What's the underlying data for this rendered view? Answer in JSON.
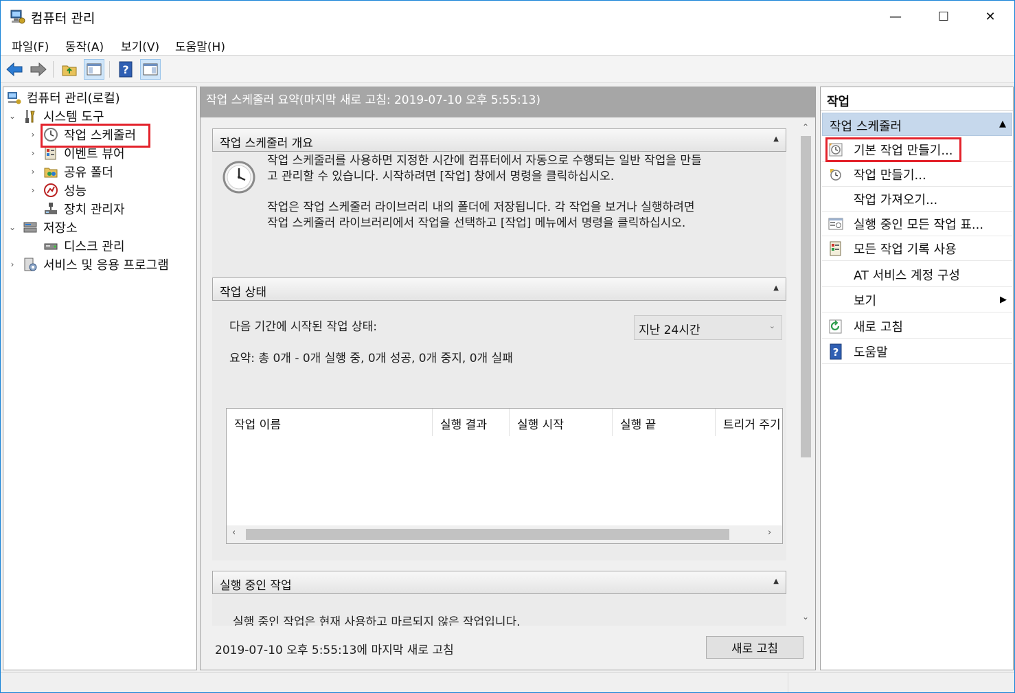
{
  "window": {
    "title": "컴퓨터 관리",
    "min_glyph": "—",
    "max_glyph": "☐",
    "close_glyph": "✕"
  },
  "menu": [
    "파일(F)",
    "동작(A)",
    "보기(V)",
    "도움말(H)"
  ],
  "toolbar": {
    "icons": [
      "back-arrow-icon",
      "forward-arrow-icon",
      "up-folder-icon",
      "show-hide-tree-icon",
      "help-icon",
      "show-hide-action-pane-icon"
    ]
  },
  "tree": {
    "items": [
      {
        "label": "컴퓨터 관리(로컬)",
        "expander": "",
        "icon": "computer-management-icon"
      },
      {
        "label": "시스템 도구",
        "expander": "⌄",
        "icon": "system-tools-icon"
      },
      {
        "label": "작업 스케줄러",
        "expander": "›",
        "icon": "clock-icon",
        "selected": true
      },
      {
        "label": "이벤트 뷰어",
        "expander": "›",
        "icon": "event-viewer-icon"
      },
      {
        "label": "공유 폴더",
        "expander": "›",
        "icon": "shared-folder-icon"
      },
      {
        "label": "성능",
        "expander": "›",
        "icon": "performance-icon"
      },
      {
        "label": "장치 관리자",
        "expander": "",
        "icon": "device-manager-icon"
      },
      {
        "label": "저장소",
        "expander": "⌄",
        "icon": "storage-icon"
      },
      {
        "label": "디스크 관리",
        "expander": "",
        "icon": "disk-management-icon"
      },
      {
        "label": "서비스 및 응용 프로그램",
        "expander": "›",
        "icon": "services-icon"
      }
    ]
  },
  "center": {
    "header": "작업 스케줄러 요약(마지막 새로 고침: 2019-07-10 오후 5:55:13)",
    "overview": {
      "title": "작업 스케줄러 개요",
      "caret": "▲",
      "para1_line1": "작업 스케줄러를 사용하면 지정한 시간에 컴퓨터에서 자동으로 수행되는 일반 작업을 만들",
      "para1_line2": "고 관리할 수 있습니다. 시작하려면 [작업] 창에서 명령을 클릭하십시오.",
      "para2_line1": "작업은 작업 스케줄러 라이브러리 내의 폴더에 저장됩니다. 각 작업을 보거나 실행하려면",
      "para2_line2": "작업 스케줄러 라이브러리에서 작업을 선택하고 [작업] 메뉴에서 명령을 클릭하십시오."
    },
    "status": {
      "title": "작업 상태",
      "caret": "▲",
      "period_label": "다음 기간에 시작된 작업 상태:",
      "period_value": "지난 24시간",
      "summary": "요약: 총 0개 - 0개 실행 중, 0개 성공, 0개 중지, 0개 실패",
      "columns": [
        "작업 이름",
        "실행 결과",
        "실행 시작",
        "실행 끝",
        "트리거 주기"
      ],
      "scroll_left": "‹",
      "scroll_right": "›"
    },
    "running": {
      "title": "실행 중인 작업",
      "caret": "▲",
      "text": "실행 중인 작업은 현재 사용하고 마르되지 않은 작업입니다."
    },
    "scroll_up": "⌃",
    "scroll_down": "⌄",
    "footer_text": "2019-07-10 오후 5:55:13에 마지막 새로 고침",
    "refresh_button": "새로 고침"
  },
  "actions": {
    "title": "작업",
    "group": "작업 스케줄러",
    "group_glyph": "▲",
    "submenu_glyph": "▶",
    "items": [
      {
        "label": "기본 작업 만들기...",
        "icon": "basic-task-icon"
      },
      {
        "label": "작업 만들기...",
        "icon": "create-task-icon"
      },
      {
        "label": "작업 가져오기...",
        "icon": ""
      },
      {
        "label": "실행 중인 모든 작업 표...",
        "icon": "running-tasks-icon"
      },
      {
        "label": "모든 작업 기록 사용",
        "icon": "task-history-icon"
      },
      {
        "label": "AT 서비스 계정 구성",
        "icon": ""
      },
      {
        "label": "보기",
        "icon": "",
        "submenu": true
      },
      {
        "label": "새로 고침",
        "icon": "refresh-icon"
      },
      {
        "label": "도움말",
        "icon": "help-icon"
      }
    ]
  },
  "colors": {
    "highlight_box": "#e3222b",
    "action_group_bg": "#c6d8ec",
    "center_header_bg": "#a6a6a6"
  }
}
